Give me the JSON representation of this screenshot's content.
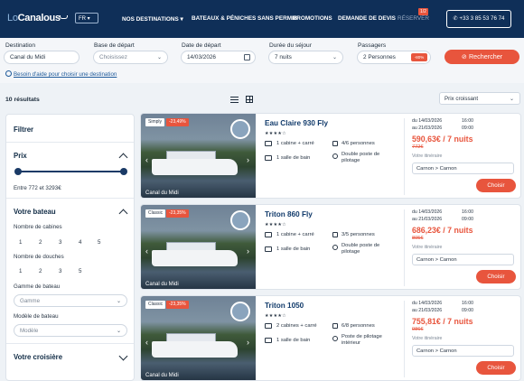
{
  "header": {
    "logo_part1": "Lo",
    "logo_part2": "Canalous",
    "lang": "FR ▾",
    "nav": [
      "NOS DESTINATIONS ▾",
      "BATEAUX & PÉNICHES SANS PERMIS",
      "PROMOTIONS",
      "DEMANDE DE DEVIS",
      "RÉSERVER"
    ],
    "cart_badge": "1/2",
    "phone": "+33 3 85 53 76 74"
  },
  "search": {
    "labels": [
      "Destination",
      "Base de départ",
      "Date de départ",
      "Durée du séjour",
      "Passagers"
    ],
    "destination": "Canal du Midi",
    "base": "Choisissez",
    "date": "14/03/2026",
    "duration": "7 nuits",
    "passengers": "2 Personnes",
    "minus_label": "-80%",
    "button": "Rechercher",
    "help": "Besoin d'aide pour choisir une destination"
  },
  "results": {
    "count": "10 résultats",
    "sort": "Prix croissant"
  },
  "filter": {
    "title": "Filtrer",
    "price_title": "Prix",
    "price_range": "Entre 772 et 3293€",
    "boat_title": "Votre bateau",
    "cabins_label": "Nombre de cabines",
    "cabins": [
      "1",
      "2",
      "3",
      "4",
      "5"
    ],
    "showers_label": "Nombre de douches",
    "showers": [
      "1",
      "2",
      "3",
      "5"
    ],
    "range_label": "Gamme de bateau",
    "range_ph": "Gamme",
    "model_label": "Modèle de bateau",
    "model_ph": "Modèle",
    "cruise_title": "Votre croisière"
  },
  "cards": [
    {
      "type": "Simply",
      "disc": "-23,49%",
      "region": "Canal du Midi",
      "name": "Eau Claire 930 Fly",
      "stars": "★★★★☆",
      "cabins": "1 cabine + carré",
      "persons": "4/6 personnes",
      "baths": "1 salle de bain",
      "pilot": "Double poste de pilotage",
      "d1": "du 14/03/2026",
      "t1": "16:00",
      "d2": "au 21/03/2026",
      "t2": "09:00",
      "price": "590,63€ / 7 nuits",
      "old": "772€",
      "itil": "Votre itinéraire",
      "itin": "Carnon > Carnon",
      "btn": "Choisir"
    },
    {
      "type": "Classic",
      "disc": "-23,35%",
      "region": "Canal du Midi",
      "name": "Triton 860 Fly",
      "stars": "★★★★☆",
      "cabins": "1 cabine + carré",
      "persons": "3/5 personnes",
      "baths": "1 salle de bain",
      "pilot": "Double poste de pilotage",
      "d1": "du 14/03/2026",
      "t1": "16:00",
      "d2": "au 21/03/2026",
      "t2": "09:00",
      "price": "686,23€ / 7 nuits",
      "old": "895€",
      "itil": "Votre itinéraire",
      "itin": "Carnon > Carnon",
      "btn": "Choisir"
    },
    {
      "type": "Classic",
      "disc": "-23,35%",
      "region": "Canal du Midi",
      "name": "Triton 1050",
      "stars": "★★★★☆",
      "cabins": "2 cabines + carré",
      "persons": "6/8 personnes",
      "baths": "1 salle de bain",
      "pilot": "Poste de pilotage intérieur",
      "d1": "du 14/03/2026",
      "t1": "16:00",
      "d2": "au 21/03/2026",
      "t2": "09:00",
      "price": "755,81€ / 7 nuits",
      "old": "986€",
      "itil": "Votre itinéraire",
      "itin": "Carnon > Carnon",
      "btn": "Choisir"
    }
  ]
}
